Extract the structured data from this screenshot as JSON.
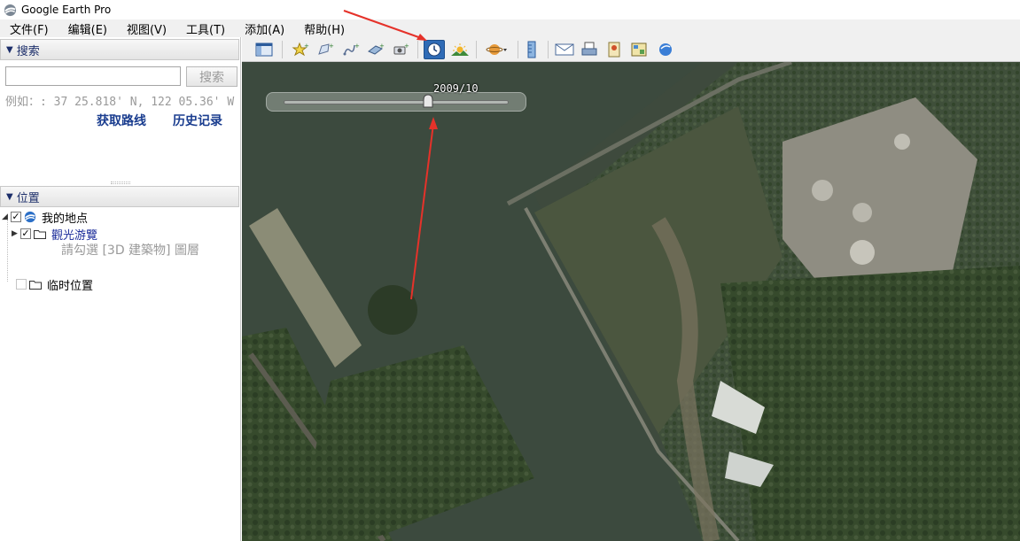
{
  "window": {
    "title": "Google Earth Pro"
  },
  "menu": [
    {
      "label": "文件(F)"
    },
    {
      "label": "编辑(E)"
    },
    {
      "label": "视图(V)"
    },
    {
      "label": "工具(T)"
    },
    {
      "label": "添加(A)"
    },
    {
      "label": "帮助(H)"
    }
  ],
  "search": {
    "header": "搜索",
    "input_value": "",
    "button_label": "搜索",
    "hint": "例如：: 37 25.818' N, 122 05.36' W",
    "directions_link": "获取路线",
    "history_link": "历史记录"
  },
  "places": {
    "header": "位置",
    "my_places": "我的地点",
    "tour": "觀光游覽",
    "tour_hint": "請勾選 [3D 建築物] 圖層",
    "temporary": "临时位置"
  },
  "toolbar": {
    "icons": [
      "sidebar-toggle-icon",
      "placemark-icon",
      "polygon-icon",
      "path-icon",
      "image-overlay-icon",
      "record-tour-icon",
      "historical-imagery-icon",
      "sunlight-icon",
      "planets-icon",
      "ruler-icon",
      "email-icon",
      "print-icon",
      "save-image-icon",
      "map-view-icon",
      "maps-icon"
    ],
    "active": "historical-imagery-icon",
    "accent": "#2f6bb6"
  },
  "historical_imagery": {
    "date_label": "2009/10",
    "slider_position": 0.64
  },
  "annotation_color": "#e5322a"
}
